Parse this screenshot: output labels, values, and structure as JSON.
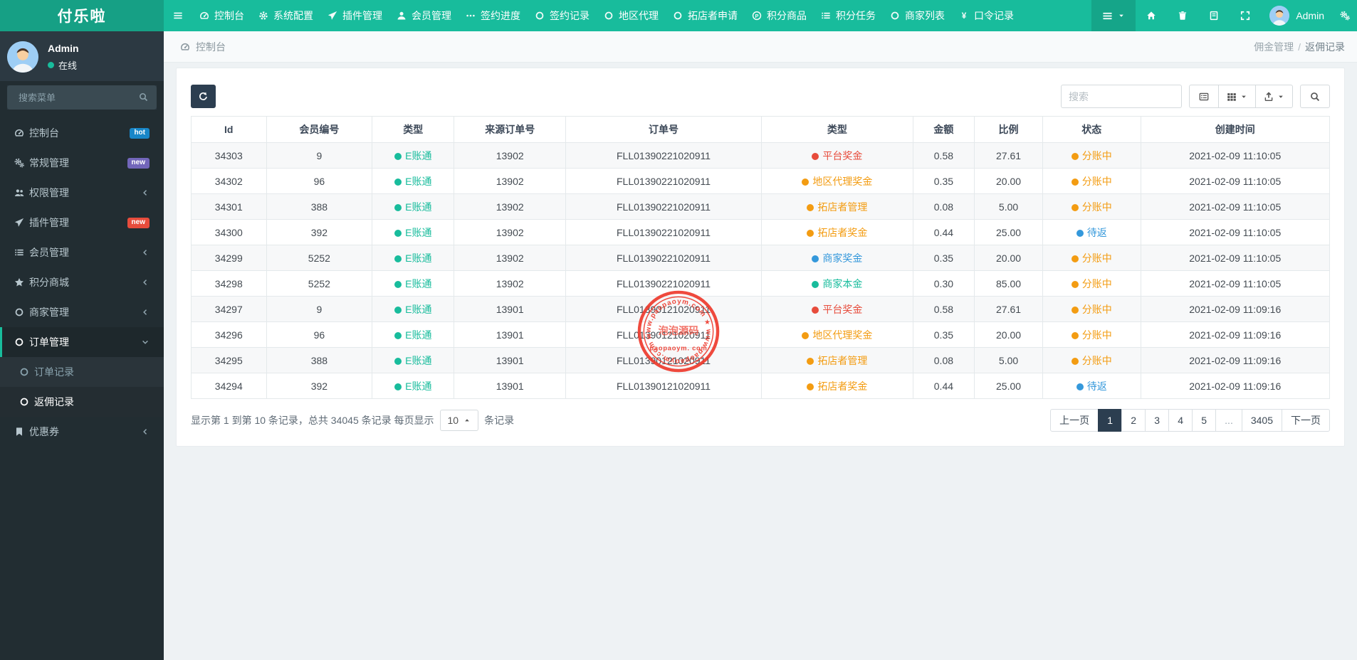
{
  "colors": {
    "teal": "#18bc9c",
    "red": "#e74c3c",
    "orange": "#f39c12",
    "blue": "#3498db",
    "navy": "#2c3e50"
  },
  "navbar": {
    "brand": "付乐啦",
    "items": [
      {
        "icon": "bars",
        "label": ""
      },
      {
        "icon": "dashboard",
        "label": "控制台"
      },
      {
        "icon": "gear",
        "label": "系统配置"
      },
      {
        "icon": "paper-plane",
        "label": "插件管理"
      },
      {
        "icon": "user",
        "label": "会员管理"
      },
      {
        "icon": "ellipsis",
        "label": "签约进度"
      },
      {
        "icon": "circle",
        "label": "签约记录"
      },
      {
        "icon": "circle",
        "label": "地区代理"
      },
      {
        "icon": "circle",
        "label": "拓店者申请"
      },
      {
        "icon": "circle-p",
        "label": "积分商品"
      },
      {
        "icon": "list",
        "label": "积分任务"
      },
      {
        "icon": "circle",
        "label": "商家列表"
      },
      {
        "icon": "yen",
        "label": "口令记录"
      }
    ],
    "user_name": "Admin"
  },
  "sidebar": {
    "user": {
      "name": "Admin",
      "status": "在线"
    },
    "search_placeholder": "搜索菜单",
    "items": [
      {
        "icon": "dashboard",
        "label": "控制台",
        "badge": "hot",
        "badge_color": "#1886c8"
      },
      {
        "icon": "cogs",
        "label": "常规管理",
        "badge": "new",
        "badge_color": "#7266ba"
      },
      {
        "icon": "users",
        "label": "权限管理",
        "arrow": "left"
      },
      {
        "icon": "paper-plane",
        "label": "插件管理",
        "badge": "new",
        "badge_color": "#e74c3c"
      },
      {
        "icon": "list",
        "label": "会员管理",
        "arrow": "left"
      },
      {
        "icon": "star",
        "label": "积分商城",
        "arrow": "left"
      },
      {
        "icon": "circle",
        "label": "商家管理",
        "arrow": "left"
      },
      {
        "icon": "circle",
        "label": "订单管理",
        "arrow": "down",
        "active": true,
        "children": [
          {
            "icon": "circle",
            "label": "订单记录"
          },
          {
            "icon": "circle",
            "label": "返佣记录",
            "active": true
          }
        ]
      },
      {
        "icon": "bookmark",
        "label": "优惠券",
        "arrow": "left"
      }
    ]
  },
  "breadcrumb": {
    "section": "控制台",
    "trail_parent": "佣金管理",
    "trail_sep": "/",
    "trail_current": "返佣记录"
  },
  "toolbar": {
    "search_placeholder": "搜索"
  },
  "table": {
    "columns": [
      "Id",
      "会员编号",
      "类型",
      "来源订单号",
      "订单号",
      "类型",
      "金额",
      "比例",
      "状态",
      "创建时间"
    ],
    "col_widths": [
      "6.6%",
      "9.3%",
      "7.2%",
      "9.8%",
      "17.2%",
      "13.3%",
      "5.4%",
      "6.0%",
      "8.6%",
      "16.6%"
    ],
    "rows": [
      {
        "id": "34303",
        "member_no": "9",
        "account_type": "E账通",
        "account_color": "teal",
        "source_order": "13902",
        "order_no": "FLL01390221020911",
        "bonus_type": "平台奖金",
        "bonus_color": "red",
        "amount": "0.58",
        "ratio": "27.61",
        "status": "分账中",
        "status_color": "orange",
        "created": "2021-02-09 11:10:05"
      },
      {
        "id": "34302",
        "member_no": "96",
        "account_type": "E账通",
        "account_color": "teal",
        "source_order": "13902",
        "order_no": "FLL01390221020911",
        "bonus_type": "地区代理奖金",
        "bonus_color": "orange",
        "amount": "0.35",
        "ratio": "20.00",
        "status": "分账中",
        "status_color": "orange",
        "created": "2021-02-09 11:10:05"
      },
      {
        "id": "34301",
        "member_no": "388",
        "account_type": "E账通",
        "account_color": "teal",
        "source_order": "13902",
        "order_no": "FLL01390221020911",
        "bonus_type": "拓店者管理",
        "bonus_color": "orange",
        "amount": "0.08",
        "ratio": "5.00",
        "status": "分账中",
        "status_color": "orange",
        "created": "2021-02-09 11:10:05"
      },
      {
        "id": "34300",
        "member_no": "392",
        "account_type": "E账通",
        "account_color": "teal",
        "source_order": "13902",
        "order_no": "FLL01390221020911",
        "bonus_type": "拓店者奖金",
        "bonus_color": "orange",
        "amount": "0.44",
        "ratio": "25.00",
        "status": "待返",
        "status_color": "blue",
        "created": "2021-02-09 11:10:05"
      },
      {
        "id": "34299",
        "member_no": "5252",
        "account_type": "E账通",
        "account_color": "teal",
        "source_order": "13902",
        "order_no": "FLL01390221020911",
        "bonus_type": "商家奖金",
        "bonus_color": "blue",
        "amount": "0.35",
        "ratio": "20.00",
        "status": "分账中",
        "status_color": "orange",
        "created": "2021-02-09 11:10:05"
      },
      {
        "id": "34298",
        "member_no": "5252",
        "account_type": "E账通",
        "account_color": "teal",
        "source_order": "13902",
        "order_no": "FLL01390221020911",
        "bonus_type": "商家本金",
        "bonus_color": "teal",
        "amount": "0.30",
        "ratio": "85.00",
        "status": "分账中",
        "status_color": "orange",
        "created": "2021-02-09 11:10:05"
      },
      {
        "id": "34297",
        "member_no": "9",
        "account_type": "E账通",
        "account_color": "teal",
        "source_order": "13901",
        "order_no": "FLL01390121020911",
        "bonus_type": "平台奖金",
        "bonus_color": "red",
        "amount": "0.58",
        "ratio": "27.61",
        "status": "分账中",
        "status_color": "orange",
        "created": "2021-02-09 11:09:16"
      },
      {
        "id": "34296",
        "member_no": "96",
        "account_type": "E账通",
        "account_color": "teal",
        "source_order": "13901",
        "order_no": "FLL01390121020911",
        "bonus_type": "地区代理奖金",
        "bonus_color": "orange",
        "amount": "0.35",
        "ratio": "20.00",
        "status": "分账中",
        "status_color": "orange",
        "created": "2021-02-09 11:09:16"
      },
      {
        "id": "34295",
        "member_no": "388",
        "account_type": "E账通",
        "account_color": "teal",
        "source_order": "13901",
        "order_no": "FLL01390121020911",
        "bonus_type": "拓店者管理",
        "bonus_color": "orange",
        "amount": "0.08",
        "ratio": "5.00",
        "status": "分账中",
        "status_color": "orange",
        "created": "2021-02-09 11:09:16"
      },
      {
        "id": "34294",
        "member_no": "392",
        "account_type": "E账通",
        "account_color": "teal",
        "source_order": "13901",
        "order_no": "FLL01390121020911",
        "bonus_type": "拓店者奖金",
        "bonus_color": "orange",
        "amount": "0.44",
        "ratio": "25.00",
        "status": "待返",
        "status_color": "blue",
        "created": "2021-02-09 11:09:16"
      }
    ]
  },
  "footer": {
    "summary_left": "显示第 1 到第 10 条记录，总共 34045 条记录 每页显示",
    "page_size": "10",
    "summary_right": "条记录"
  },
  "pagination": {
    "items": [
      {
        "label": "上一页"
      },
      {
        "label": "1",
        "active": true
      },
      {
        "label": "2"
      },
      {
        "label": "3"
      },
      {
        "label": "4"
      },
      {
        "label": "5"
      },
      {
        "label": "...",
        "disabled": true
      },
      {
        "label": "3405"
      },
      {
        "label": "下一页"
      }
    ]
  },
  "watermark": {
    "ring_text": "www.paopaoym.com",
    "center_cn": "泡泡源码",
    "center_en": "paopaoym. com",
    "color": "#ee3b2e"
  }
}
